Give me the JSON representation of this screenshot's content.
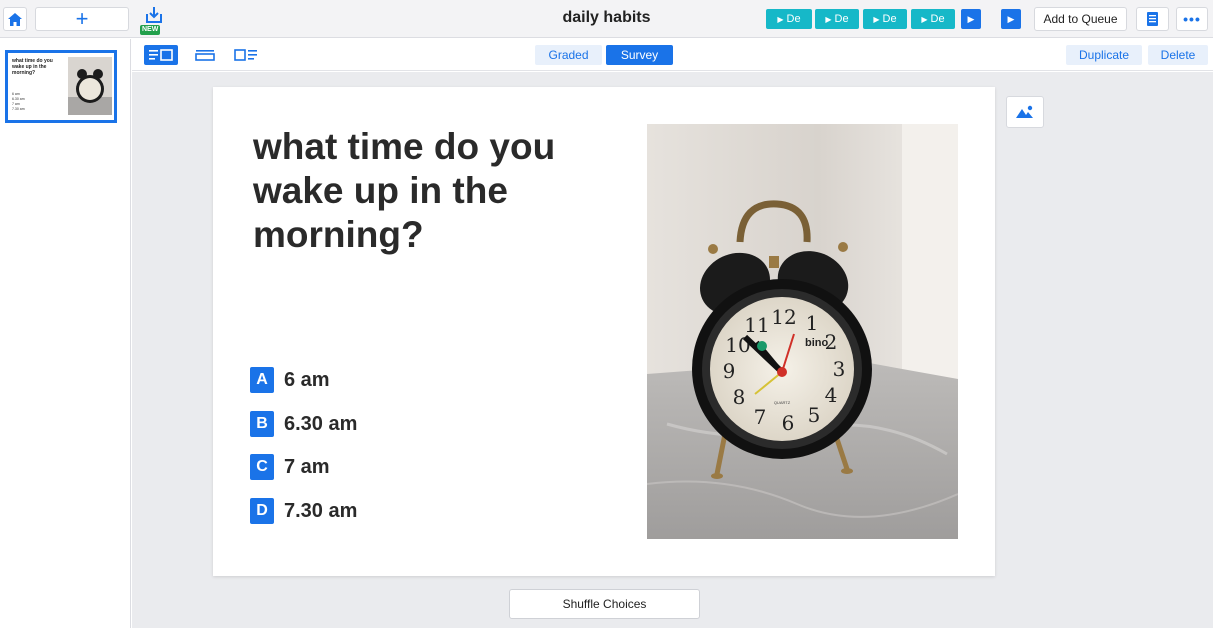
{
  "topbar": {
    "title": "daily habits",
    "new_badge": "NEW",
    "add_icon": "plus-icon",
    "home_icon": "home-icon",
    "import_icon": "import-download-icon",
    "de_buttons": [
      "De",
      "De",
      "De",
      "De"
    ],
    "add_to_queue_label": "Add to Queue",
    "notes_icon": "document-icon",
    "more_label": "•••"
  },
  "subbar": {
    "layouts": [
      "text-image-layout-icon",
      "stacked-layout-icon",
      "image-text-layout-icon"
    ],
    "tabs": [
      {
        "label": "Graded",
        "active": false
      },
      {
        "label": "Survey",
        "active": true
      }
    ],
    "duplicate_label": "Duplicate",
    "delete_label": "Delete"
  },
  "sidebar": {
    "thumbnail": {
      "question": "what time do you wake up in the morning?",
      "choices": [
        "6 am",
        "6.30 am",
        "7 am",
        "7.30 am"
      ]
    }
  },
  "slide": {
    "question": "what time do you wake up in the morning?",
    "choices": [
      {
        "letter": "A",
        "text": "6 am"
      },
      {
        "letter": "B",
        "text": "6.30 am"
      },
      {
        "letter": "C",
        "text": "7 am"
      },
      {
        "letter": "D",
        "text": "7.30 am"
      }
    ],
    "image_subject": "alarm-clock-photo",
    "clock_brand": "bino",
    "clock_face_label": "QUARTZ",
    "clock_numbers": [
      "12",
      "1",
      "2",
      "3",
      "4",
      "5",
      "6",
      "7",
      "8",
      "9",
      "10",
      "11"
    ]
  },
  "shuffle_label": "Shuffle Choices",
  "colors": {
    "accent": "#1a73e8",
    "teal": "#16b8c8",
    "new_badge": "#22a04c",
    "canvas_bg": "#eaebee"
  }
}
